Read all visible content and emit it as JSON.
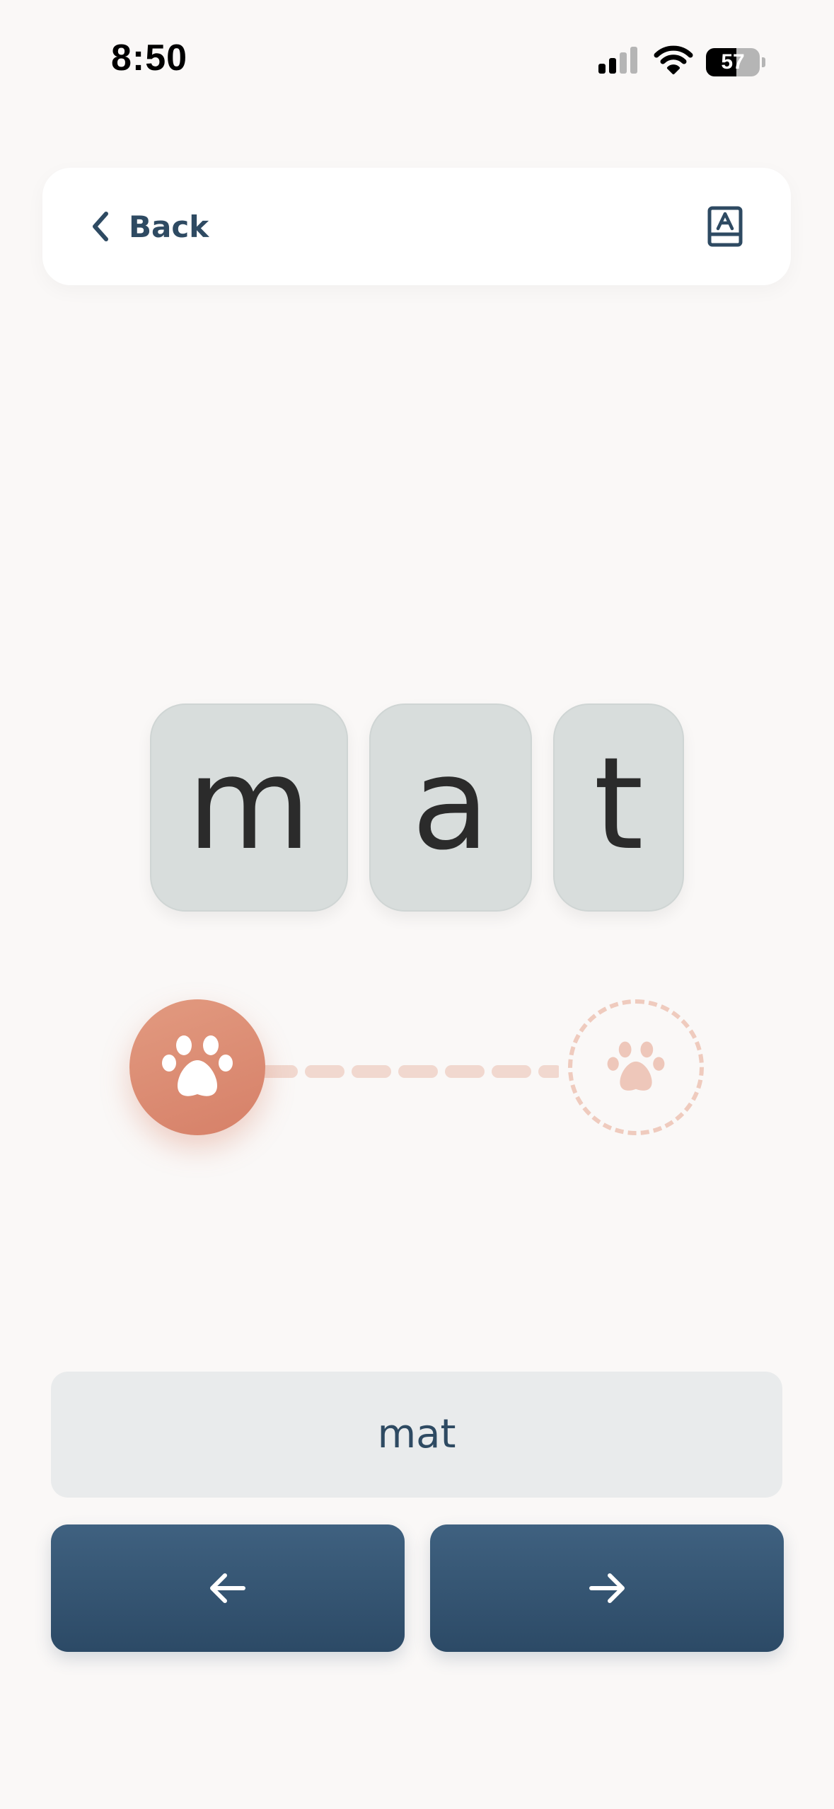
{
  "status_bar": {
    "time": "8:50",
    "battery_level": "57",
    "icons": [
      "signal-icon",
      "wifi-icon",
      "battery-icon"
    ]
  },
  "header": {
    "back_label": "Back",
    "back_icon": "chevron-left-icon",
    "action_icon": "book-icon"
  },
  "letter_tiles": [
    "m",
    "a",
    "t"
  ],
  "progress": {
    "start_icon": "paw-icon",
    "end_icon": "paw-icon",
    "completed": 0
  },
  "word": "mat",
  "navigation": {
    "prev_icon": "arrow-left-icon",
    "next_icon": "arrow-right-icon"
  },
  "colors": {
    "background": "#faf8f7",
    "primary_text": "#2e4a62",
    "tile": "#d8dddc",
    "accent": "#d68068",
    "accent_light": "#efcbbe",
    "button": "#2c4a66",
    "word_box": "#e9ebec"
  }
}
